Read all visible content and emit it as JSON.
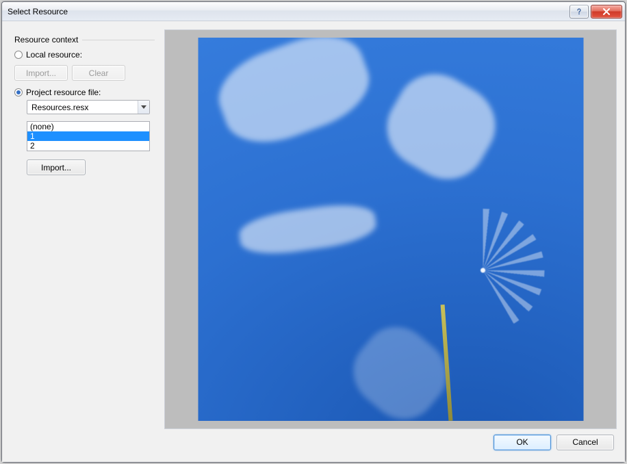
{
  "window": {
    "title": "Select Resource"
  },
  "group": {
    "label": "Resource context"
  },
  "localRadio": {
    "label": "Local resource:",
    "checked": false
  },
  "projRadio": {
    "label": "Project resource file:",
    "checked": true
  },
  "localButtons": {
    "import": "Import...",
    "clear": "Clear"
  },
  "combo": {
    "value": "Resources.resx"
  },
  "list": {
    "items": [
      "(none)",
      "1",
      "2"
    ],
    "selectedIndex": 1
  },
  "projImport": "Import...",
  "footer": {
    "ok": "OK",
    "cancel": "Cancel"
  }
}
